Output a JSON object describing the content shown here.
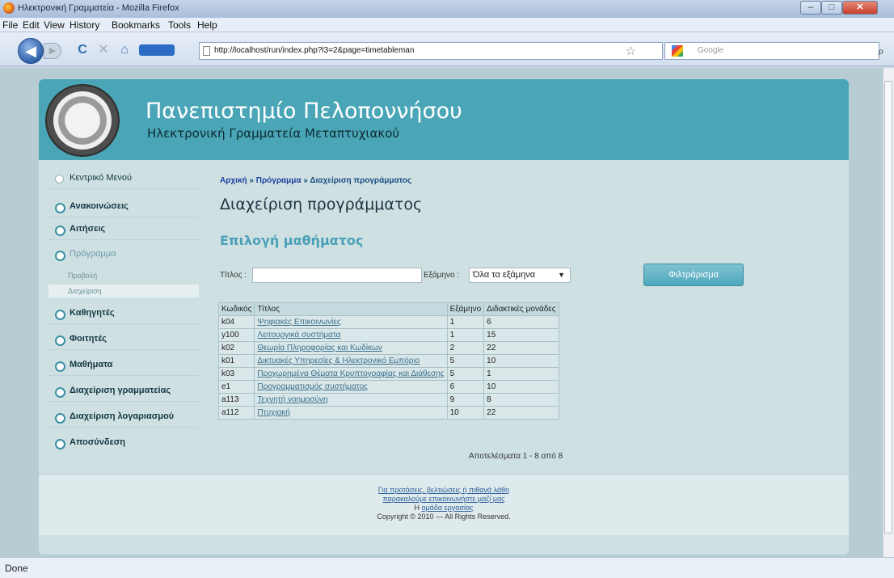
{
  "window": {
    "title": "Ηλεκτρονική Γραμματεία - Mozilla Firefox",
    "controls": {
      "minimize": "–",
      "maximize": "□",
      "close": "✕"
    }
  },
  "menu": [
    "File",
    "Edit",
    "View",
    "History",
    "Bookmarks",
    "Tools",
    "Help"
  ],
  "nav": {
    "url": "http://localhost/run/index.php?l3=2&page=timetableman",
    "search_placeholder": "Google",
    "back_glyph": "◀",
    "forward_glyph": "▶",
    "reload_glyph": "C",
    "stop_glyph": "✕",
    "home_glyph": "⌂",
    "star_glyph": "☆",
    "search_go_glyph": "⌕"
  },
  "header": {
    "title": "Πανεπιστημίο Πελοποννήσου",
    "subtitle": "Ηλεκτρονική Γραμματεία Μεταπτυχιακού"
  },
  "sidebar": {
    "items": [
      {
        "label": "Κεντρικό Μενού",
        "style": "empty"
      },
      {
        "label": "Ανακοινώσεις"
      },
      {
        "label": "Αιτήσεις"
      },
      {
        "label": "Πρόγραμμα",
        "light": true
      },
      {
        "label": "Καθηγητές"
      },
      {
        "label": "Φοιτητές"
      },
      {
        "label": "Μαθήματα"
      },
      {
        "label": "Διαχείριση γραμματείας"
      },
      {
        "label": "Διαχείριση λογαριασμού"
      },
      {
        "label": "Αποσύνδεση"
      }
    ],
    "subitems": [
      "Προβολή",
      "Διαχείριση"
    ]
  },
  "breadcrumb": {
    "home": "Αρχική",
    "sep": "»",
    "program": "Πρόγραμμα",
    "current": "Διαχείριση προγράμματος"
  },
  "page_title": "Διαχείριση προγράμματος",
  "section_title": "Επιλογή μαθήματος",
  "filters": {
    "title_label": "Τίτλος :",
    "semester_label": "Εξάμηνο :",
    "semester_value": "Όλα τα εξάμηνα",
    "button": "Φιλτράρισμα"
  },
  "table": {
    "headers": [
      "Κωδικός",
      "Τίτλος",
      "Εξάμηνο",
      "Διδακτικές μονάδες"
    ],
    "rows": [
      [
        "k04",
        "Ψηφιακές Επικοινωνίες",
        "1",
        "6"
      ],
      [
        "y100",
        "Λειτουργικά συστήματα",
        "1",
        "15"
      ],
      [
        "k02",
        "Θεωρία Πληροφορίας και Κωδίκων",
        "2",
        "22"
      ],
      [
        "k01",
        "Δικτυακές Υπηρεσίες & Ηλεκτρονικό Εμπόριο",
        "5",
        "10"
      ],
      [
        "k03",
        "Προχωρημένα Θέματα Κρυπτογραφίας και Διάθεσης",
        "5",
        "1"
      ],
      [
        "e1",
        "Προγραμματισμός συστήματος",
        "6",
        "10"
      ],
      [
        "a113",
        "Τεχνητή νοημοσύνη",
        "9",
        "8"
      ],
      [
        "a112",
        "Πτυχιακή",
        "10",
        "22"
      ]
    ],
    "results": "Αποτελέσματα 1 - 8 από 8"
  },
  "footer": {
    "line1": "Για προτάσεις, βελτιώσεις ή πιθανά λάθη",
    "line2": "παρακαλούμε επικοινωνήστε μαζί μας",
    "line3_prefix": "Η ",
    "line3_link": "ομάδα εργασίας",
    "copyright": "Copyright © 2010 — All Rights Reserved."
  },
  "status": "Done"
}
